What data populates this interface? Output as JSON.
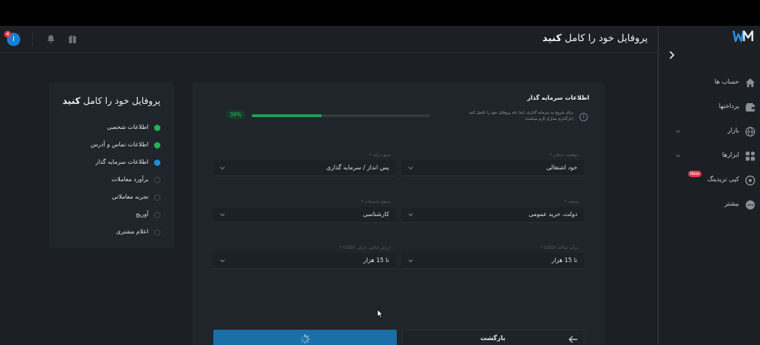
{
  "header": {
    "title_prefix": "پروفایل خود را کامل ",
    "title_bold": "کنید",
    "avatar_initial": "I",
    "notification_count": "4"
  },
  "sidebar": {
    "items": [
      {
        "label": "حساب ها",
        "icon": "home-icon",
        "has_chevron": false
      },
      {
        "label": "پرداختها",
        "icon": "wallet-icon",
        "has_chevron": false
      },
      {
        "label": "بازار",
        "icon": "globe-icon",
        "has_chevron": true
      },
      {
        "label": "ابزارها",
        "icon": "grid-icon",
        "has_chevron": true
      },
      {
        "label": "کپی تریدینگ",
        "icon": "copy-trading-icon",
        "has_chevron": false,
        "tag": "New"
      },
      {
        "label": "بیشتر",
        "icon": "more-icon",
        "has_chevron": false
      }
    ]
  },
  "steps": {
    "title_prefix": "پروفایل خود را کامل ",
    "title_bold": "کنید",
    "items": [
      {
        "label": "اطلاعات شخصی",
        "status": "done"
      },
      {
        "label": "اطلاعات تماس و آدرس",
        "status": "done"
      },
      {
        "label": "اطلاعات سرمایه گذار",
        "status": "active"
      },
      {
        "label": "برآورد معاملات",
        "status": "pending"
      },
      {
        "label": "تجربه معاملاتی",
        "status": "pending"
      },
      {
        "label": "آوریج",
        "status": "pending"
      },
      {
        "label": "اعلام مشتری",
        "status": "pending"
      }
    ]
  },
  "form": {
    "title": "اطلاعات سرمایه گذار",
    "info_text": "برای شروع به سرمایه گذاری، ابتدا باید پروفایل خود را تکمیل کنید (بارگذاری مدارک لازم میباشد)",
    "progress_percent": 39,
    "progress_label": "39%",
    "fields": {
      "employment_status": {
        "label": "موقعیت شغلی *",
        "value": "خود اشتغالی"
      },
      "income_source": {
        "label": "منبع درآمد *",
        "value": "پس انداز / سرمایه گذاری"
      },
      "industry": {
        "label": "صنعت *",
        "value": "دولت، خرید عمومی"
      },
      "education": {
        "label": "سطح تحصیلات *",
        "value": "کارشناسی"
      },
      "annual_income": {
        "label": "درآمد سالانه (USD) *",
        "value": "تا 15 هزار"
      },
      "net_worth": {
        "label": "ارزش خالص دارایی (USD) *",
        "value": "تا 15 هزار"
      }
    },
    "back_label": "بازگشت"
  },
  "colors": {
    "accent": "#1a6fa8",
    "success": "#23b25a",
    "active_step": "#1a8fe0",
    "badge": "#e0334a"
  }
}
